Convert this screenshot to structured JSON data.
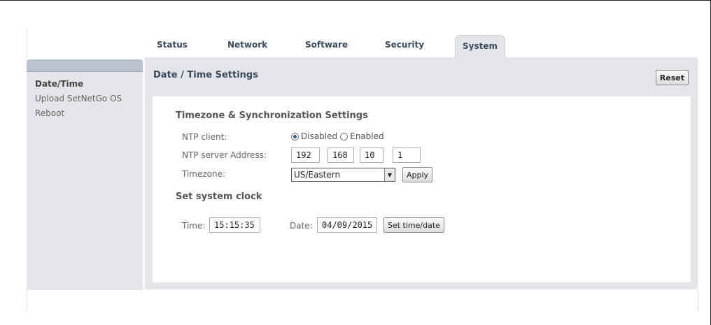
{
  "tabs": [
    {
      "label": "Status"
    },
    {
      "label": "Network"
    },
    {
      "label": "Software"
    },
    {
      "label": "Security"
    },
    {
      "label": "System",
      "active": true
    }
  ],
  "sidebar": {
    "items": [
      {
        "label": "Date/Time",
        "active": true
      },
      {
        "label": "Upload SetNetGo OS"
      },
      {
        "label": "Reboot"
      }
    ]
  },
  "panel": {
    "title": "Date / Time Settings",
    "reset_label": "Reset"
  },
  "timezone_section": {
    "title": "Timezone & Synchronization Settings",
    "ntp_client_label": "NTP client:",
    "ntp_options": [
      {
        "label": "Disabled",
        "checked": true
      },
      {
        "label": "Enabled",
        "checked": false
      }
    ],
    "ntp_server_label": "NTP server Address:",
    "ntp_server_octets": [
      "192",
      "168",
      "10",
      "1"
    ],
    "timezone_label": "Timezone:",
    "timezone_value": "US/Eastern",
    "apply_label": "Apply"
  },
  "clock_section": {
    "title": "Set system clock",
    "time_label": "Time:",
    "time_value": "15:15:35",
    "date_label": "Date:",
    "date_value": "04/09/2015",
    "set_button_label": "Set time/date"
  },
  "colors": {
    "panel_bg": "#e3e5e8",
    "tab_text": "#3c4a60",
    "sidebar_header": "#b9c3d2",
    "radio_dot": "#2d5b9e"
  }
}
